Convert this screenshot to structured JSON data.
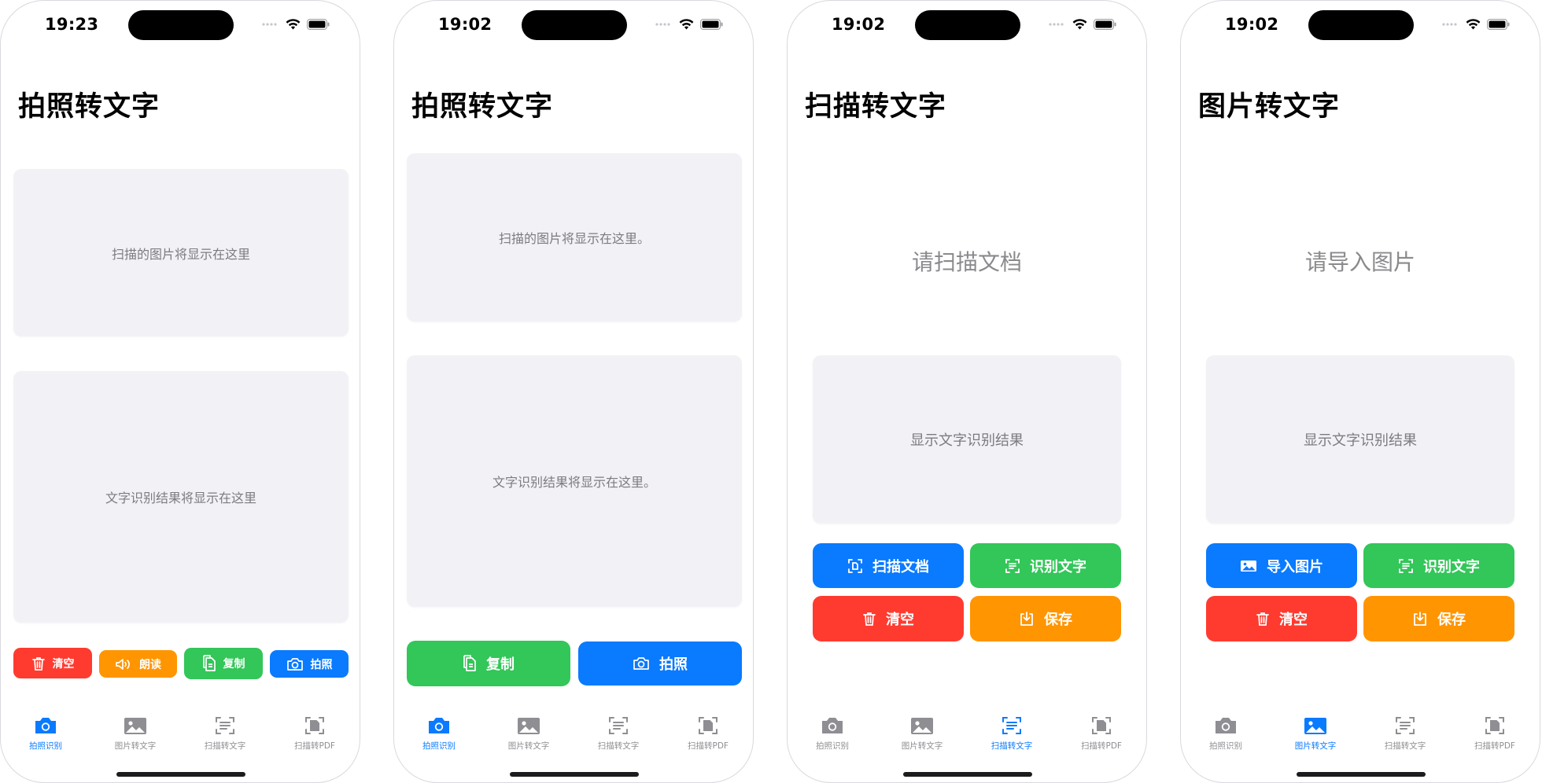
{
  "colors": {
    "accent": "#0a7aff",
    "green": "#33c659",
    "red": "#ff3b30",
    "orange": "#ff9500",
    "placeholder_bg": "#f2f2f6",
    "inactive_tab": "#8e8e93"
  },
  "tab_labels": [
    "拍照识别",
    "图片转文字",
    "扫描转文字",
    "扫描转PDF"
  ],
  "tab_icons": [
    "camera-icon",
    "photo-icon",
    "text-scan-icon",
    "doc-scan-icon"
  ],
  "screens": [
    {
      "time": "19:23",
      "title": "拍照转文字",
      "image_placeholder": "扫描的图片将显示在这里",
      "result_placeholder": "文字识别结果将显示在这里",
      "buttons": [
        {
          "label": "清空",
          "icon": "trash-icon",
          "color": "red"
        },
        {
          "label": "朗读",
          "icon": "speaker-icon",
          "color": "orange"
        },
        {
          "label": "复制",
          "icon": "copy-icon",
          "color": "green"
        },
        {
          "label": "拍照",
          "icon": "camera-icon",
          "color": "blue"
        }
      ],
      "active_tab": 0
    },
    {
      "time": "19:02",
      "title": "拍照转文字",
      "image_placeholder": "扫描的图片将显示在这里。",
      "result_placeholder": "文字识别结果将显示在这里。",
      "buttons": [
        {
          "label": "复制",
          "icon": "copy-icon",
          "color": "green"
        },
        {
          "label": "拍照",
          "icon": "camera-icon",
          "color": "blue"
        }
      ],
      "active_tab": 0
    },
    {
      "time": "19:02",
      "title": "扫描转文字",
      "prompt": "请扫描文档",
      "result_placeholder": "显示文字识别结果",
      "buttons": [
        {
          "label": "扫描文档",
          "icon": "doc-scan-icon",
          "color": "blue"
        },
        {
          "label": "识别文字",
          "icon": "text-scan-icon",
          "color": "green"
        },
        {
          "label": "清空",
          "icon": "trash-icon",
          "color": "red"
        },
        {
          "label": "保存",
          "icon": "save-icon",
          "color": "orange"
        }
      ],
      "active_tab": 2
    },
    {
      "time": "19:02",
      "title": "图片转文字",
      "prompt": "请导入图片",
      "result_placeholder": "显示文字识别结果",
      "buttons": [
        {
          "label": "导入图片",
          "icon": "photo-icon",
          "color": "blue"
        },
        {
          "label": "识别文字",
          "icon": "text-scan-icon",
          "color": "green"
        },
        {
          "label": "清空",
          "icon": "trash-icon",
          "color": "red"
        },
        {
          "label": "保存",
          "icon": "save-icon",
          "color": "orange"
        }
      ],
      "active_tab": 1
    }
  ]
}
